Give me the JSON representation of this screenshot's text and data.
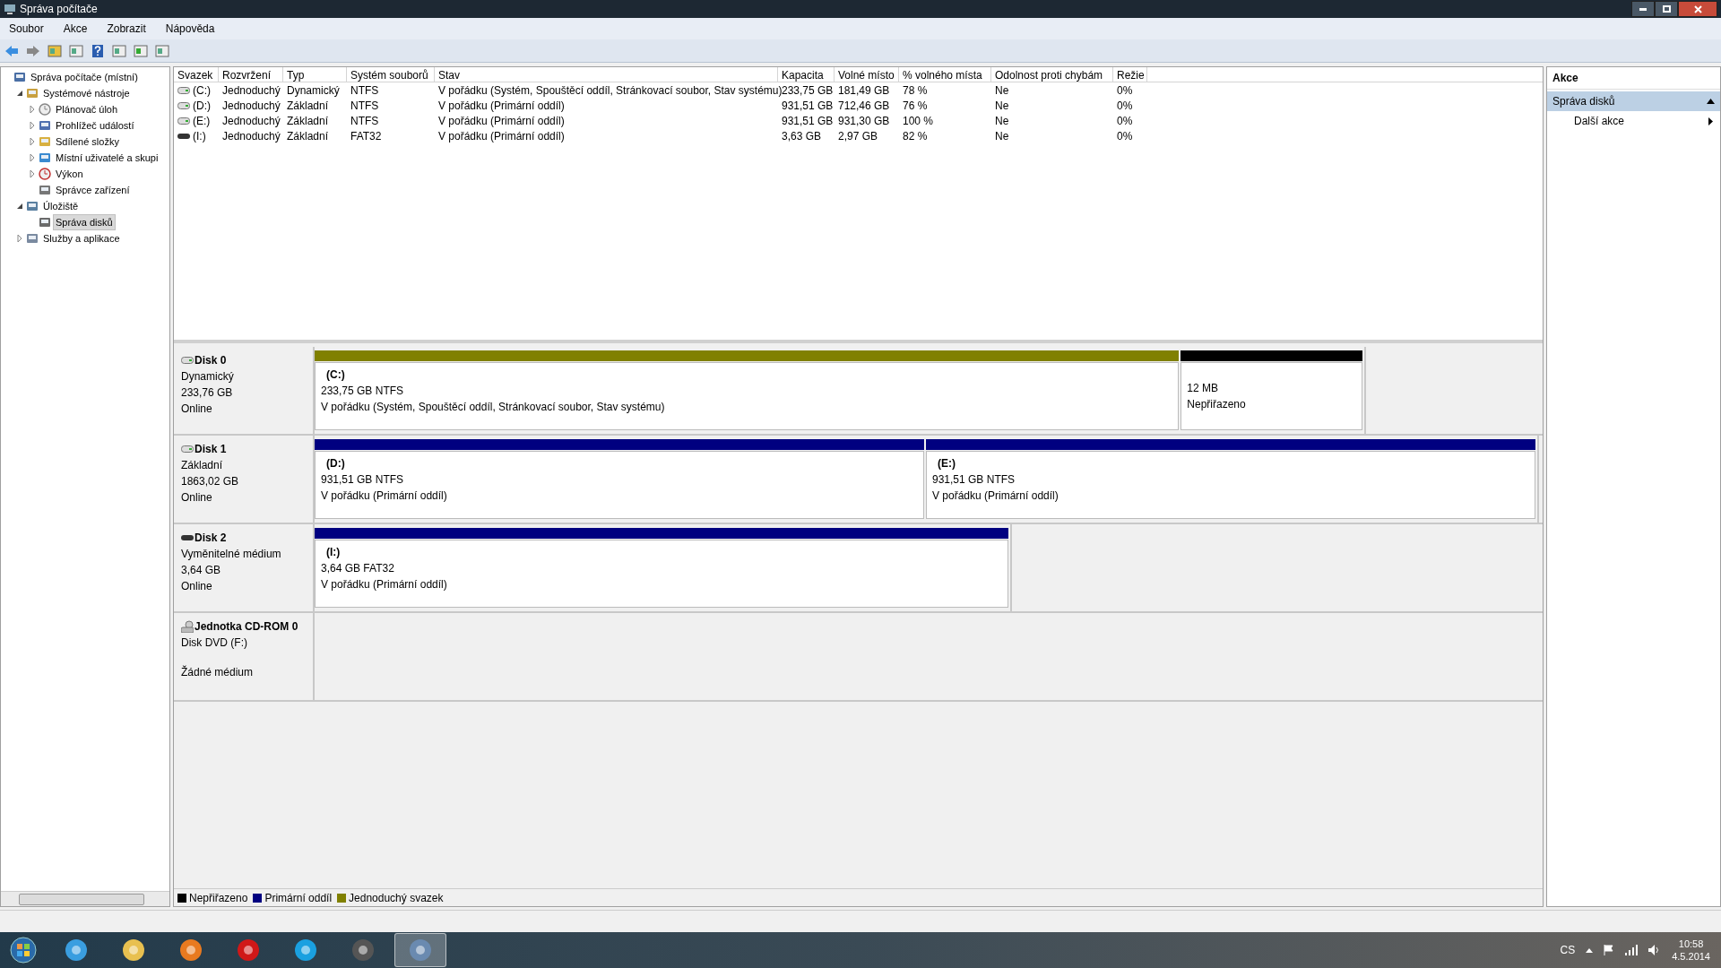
{
  "window": {
    "title": "Správa počítače"
  },
  "menu": [
    "Soubor",
    "Akce",
    "Zobrazit",
    "Nápověda"
  ],
  "tree": [
    {
      "label": "Správa počítače (místní)",
      "kind": "computer",
      "selected": false,
      "children": [
        {
          "label": "Systémové nástroje",
          "kind": "tools",
          "expanded": true,
          "selected": false,
          "children": [
            {
              "label": "Plánovač úloh",
              "kind": "clock",
              "expanded": false,
              "selected": false
            },
            {
              "label": "Prohlížeč událostí",
              "kind": "events",
              "expanded": false,
              "selected": false
            },
            {
              "label": "Sdílené složky",
              "kind": "shared",
              "expanded": false,
              "selected": false
            },
            {
              "label": "Místní uživatelé a skupi",
              "kind": "users",
              "expanded": false,
              "selected": false
            },
            {
              "label": "Výkon",
              "kind": "performance",
              "expanded": false,
              "selected": false
            },
            {
              "label": "Správce zařízení",
              "kind": "devices",
              "selected": false
            }
          ]
        },
        {
          "label": "Úložiště",
          "kind": "storage",
          "expanded": true,
          "selected": false,
          "children": [
            {
              "label": "Správa disků",
              "kind": "disk",
              "selected": true
            }
          ]
        },
        {
          "label": "Služby a aplikace",
          "kind": "services",
          "expanded": false,
          "selected": false
        }
      ]
    }
  ],
  "table": {
    "columns": [
      "Svazek",
      "Rozvržení",
      "Typ",
      "Systém souborů",
      "Stav",
      "Kapacita",
      "Volné místo",
      "% volného místa",
      "Odolnost proti chybám",
      "Režie"
    ],
    "rows": [
      {
        "kind": "fixed",
        "cells": [
          "(C:)",
          "Jednoduchý",
          "Dynamický",
          "NTFS",
          "V pořádku (Systém, Spouštěcí oddíl, Stránkovací soubor, Stav systému)",
          "233,75 GB",
          "181,49 GB",
          "78 %",
          "Ne",
          "0%"
        ]
      },
      {
        "kind": "fixed",
        "cells": [
          "(D:)",
          "Jednoduchý",
          "Základní",
          "NTFS",
          "V pořádku (Primární oddíl)",
          "931,51 GB",
          "712,46 GB",
          "76 %",
          "Ne",
          "0%"
        ]
      },
      {
        "kind": "fixed",
        "cells": [
          "(E:)",
          "Jednoduchý",
          "Základní",
          "NTFS",
          "V pořádku (Primární oddíl)",
          "931,51 GB",
          "931,30 GB",
          "100 %",
          "Ne",
          "0%"
        ]
      },
      {
        "kind": "removable",
        "cells": [
          "(I:)",
          "Jednoduchý",
          "Základní",
          "FAT32",
          "V pořádku (Primární oddíl)",
          "3,63 GB",
          "2,97 GB",
          "82 %",
          "Ne",
          "0%"
        ]
      }
    ]
  },
  "disks": [
    {
      "kind": "fixed",
      "name": "Disk 0",
      "lines": [
        "Dynamický",
        "233,76 GB"
      ],
      "status": "Online",
      "partitions": [
        {
          "kind": "simple",
          "letter": "(C:)",
          "lines": [
            "233,75 GB NTFS",
            "V pořádku (Systém, Spouštěcí oddíl, Stránkovací soubor, Stav systému)"
          ]
        },
        {
          "kind": "unallocated",
          "lines": [
            "12 MB",
            "Nepřiřazeno"
          ]
        }
      ]
    },
    {
      "kind": "fixed",
      "name": "Disk 1",
      "lines": [
        "Základní",
        "1863,02 GB"
      ],
      "status": "Online",
      "partitions": [
        {
          "kind": "primary",
          "letter": "(D:)",
          "lines": [
            "931,51 GB NTFS",
            "V pořádku (Primární oddíl)"
          ]
        },
        {
          "kind": "primary",
          "letter": "(E:)",
          "lines": [
            "931,51 GB NTFS",
            "V pořádku (Primární oddíl)"
          ]
        }
      ]
    },
    {
      "kind": "removable",
      "name": "Disk 2",
      "lines": [
        "Vyměnitelné médium",
        "3,64 GB"
      ],
      "status": "Online",
      "partitions": [
        {
          "kind": "primary",
          "letter": "(I:)",
          "lines": [
            "3,64 GB FAT32",
            "V pořádku (Primární oddíl)"
          ]
        }
      ]
    },
    {
      "kind": "cdrom",
      "name": "Jednotka CD-ROM 0",
      "lines": [
        "Disk DVD (F:)"
      ],
      "status": "Žádné médium"
    }
  ],
  "legend": [
    {
      "label": "Nepřiřazeno",
      "color": "#000000"
    },
    {
      "label": "Primární oddíl",
      "color": "#000080"
    },
    {
      "label": "Jednoduchý svazek",
      "color": "#808000"
    }
  ],
  "actions": {
    "title": "Akce",
    "section": {
      "label": "Správa disků",
      "expanded": true
    },
    "items": [
      "Další akce"
    ]
  },
  "taskbar": {
    "language": "CS",
    "time": "10:58",
    "date": "4.5.2014",
    "apps": [
      {
        "kind": "browser-e",
        "active": false
      },
      {
        "kind": "folder",
        "active": false
      },
      {
        "kind": "player",
        "active": false
      },
      {
        "kind": "browser-o",
        "active": false
      },
      {
        "kind": "chat",
        "active": false
      },
      {
        "kind": "media",
        "active": false
      },
      {
        "kind": "computer",
        "active": true
      }
    ]
  }
}
